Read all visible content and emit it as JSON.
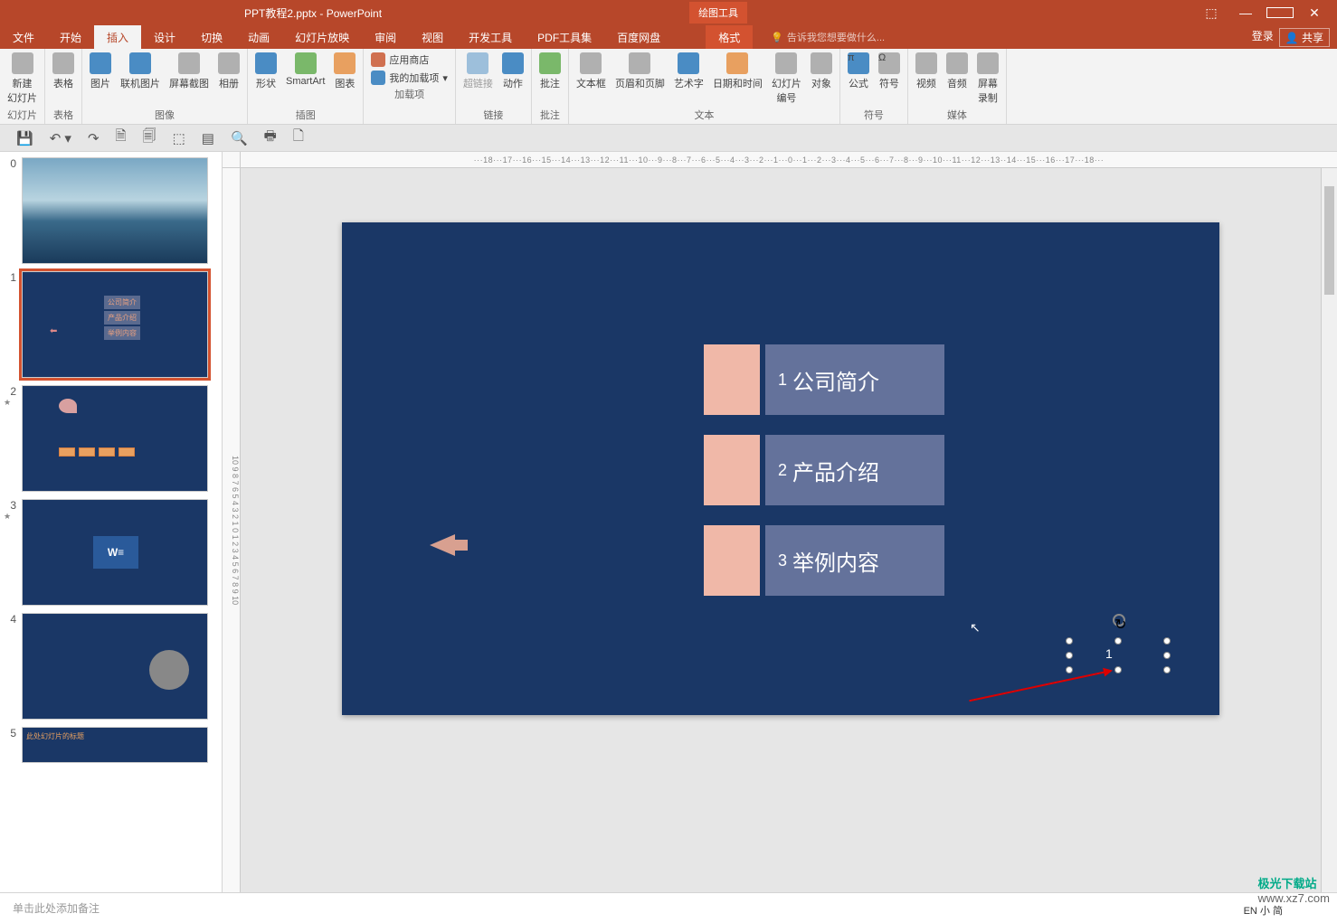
{
  "titlebar": {
    "doc_title": "PPT教程2.pptx - PowerPoint",
    "tool_context": "绘图工具"
  },
  "menubar": {
    "tabs": [
      "文件",
      "开始",
      "插入",
      "设计",
      "切换",
      "动画",
      "幻灯片放映",
      "审阅",
      "视图",
      "开发工具",
      "PDF工具集",
      "百度网盘",
      "格式"
    ],
    "active_index": 2,
    "tell_me": "告诉我您想要做什么...",
    "login": "登录",
    "share": "共享"
  },
  "ribbon": {
    "groups": [
      {
        "label": "幻灯片",
        "items": [
          "新建\n幻灯片"
        ]
      },
      {
        "label": "表格",
        "items": [
          "表格"
        ]
      },
      {
        "label": "图像",
        "items": [
          "图片",
          "联机图片",
          "屏幕截图",
          "相册"
        ]
      },
      {
        "label": "插图",
        "items": [
          "形状",
          "SmartArt",
          "图表"
        ]
      },
      {
        "label": "加载项",
        "stack": [
          "应用商店",
          "我的加载项"
        ]
      },
      {
        "label": "链接",
        "items": [
          "超链接",
          "动作"
        ]
      },
      {
        "label": "批注",
        "items": [
          "批注"
        ]
      },
      {
        "label": "文本",
        "items": [
          "文本框",
          "页眉和页脚",
          "艺术字",
          "日期和时间",
          "幻灯片\n编号",
          "对象"
        ]
      },
      {
        "label": "符号",
        "items": [
          "公式",
          "符号"
        ]
      },
      {
        "label": "媒体",
        "items": [
          "视频",
          "音频",
          "屏幕\n录制"
        ]
      }
    ]
  },
  "ruler_h": "···18···17···16···15···14···13···12···11···10···9···8···7···6···5···4···3···2···1···0···1···2···3···4···5···6···7···8···9···10···11···12···13··14···15···16···17···18···",
  "slide_canvas": {
    "rows": [
      {
        "num": "1",
        "text": "公司简介"
      },
      {
        "num": "2",
        "text": "产品介绍"
      },
      {
        "num": "3",
        "text": "举例内容"
      }
    ],
    "selected_text": "1"
  },
  "thumbnails": {
    "items": [
      {
        "num": "0",
        "type": "lake"
      },
      {
        "num": "1",
        "type": "list",
        "selected": true,
        "list": [
          "公司简介",
          "产品介绍",
          "举例内容"
        ]
      },
      {
        "num": "2",
        "type": "boxes",
        "star": true
      },
      {
        "num": "3",
        "type": "word",
        "star": true
      },
      {
        "num": "4",
        "type": "face"
      },
      {
        "num": "5",
        "type": "title",
        "title": "此处幻灯片的标题"
      }
    ]
  },
  "notes_placeholder": "单击此处添加备注",
  "watermark": {
    "logo": "极光下载站",
    "site": "www.xz7.com"
  },
  "ime": "EN 小 简"
}
